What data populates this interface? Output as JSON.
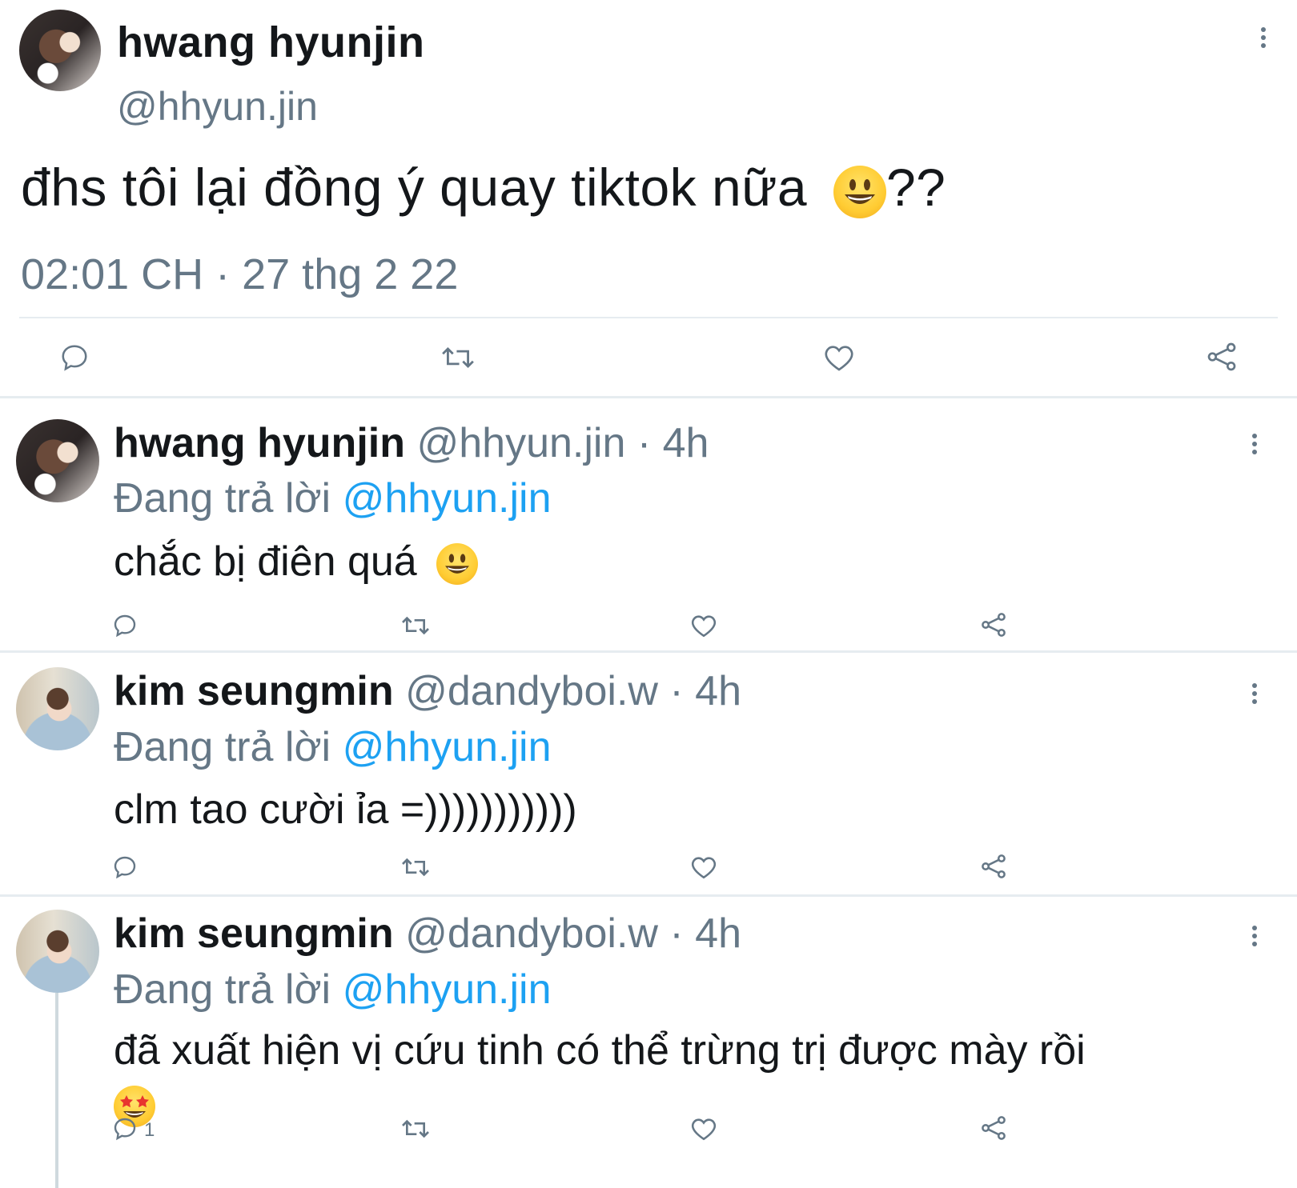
{
  "main_tweet": {
    "name": "hwang hyunjin",
    "handle": "@hhyun.jin",
    "text": "đhs tôi lại đồng ý quay tiktok nữa",
    "text_suffix": "??",
    "timestamp": "02:01 CH · 27 thg 2 22",
    "emoji": "smiley-emoji"
  },
  "replies": [
    {
      "name": "hwang hyunjin",
      "handle": "@hhyun.jin · 4h",
      "replying_label": "Đang trả lời",
      "replying_to": "@hhyun.jin",
      "text": "chắc bị điên quá",
      "emoji": "smiley-emoji",
      "reply_count": ""
    },
    {
      "name": "kim seungmin",
      "handle": "@dandyboi.w · 4h",
      "replying_label": "Đang trả lời",
      "replying_to": "@hhyun.jin",
      "text": "clm tao cười ỉa =)))))))))))",
      "reply_count": ""
    },
    {
      "name": "kim seungmin",
      "handle": "@dandyboi.w · 4h",
      "replying_label": "Đang trả lời",
      "replying_to": "@hhyun.jin",
      "text": "đã xuất hiện vị cứu tinh có thể trừng trị được mày rồi",
      "emoji": "star-struck-emoji",
      "reply_count": "1"
    }
  ],
  "icons": [
    "comment-icon",
    "retweet-icon",
    "like-icon",
    "share-icon",
    "more-icon"
  ],
  "colors": {
    "text": "#14171a",
    "secondary": "#657786",
    "link": "#1da1f2",
    "divider": "#e6ecf0"
  }
}
